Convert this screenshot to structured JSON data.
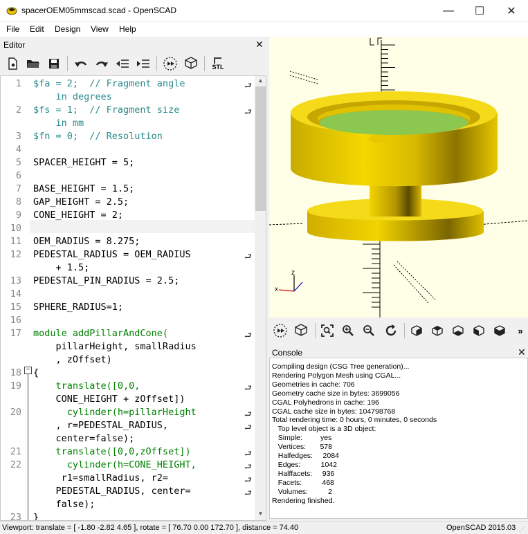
{
  "window": {
    "title": "spacerOEM05mmscad.scad - OpenSCAD",
    "minimize": "—",
    "maximize": "☐",
    "close": "✕"
  },
  "menu": [
    "File",
    "Edit",
    "Design",
    "View",
    "Help"
  ],
  "editor": {
    "title": "Editor",
    "close": "✕",
    "toolbar": [
      "new-icon",
      "open-icon",
      "save-icon",
      "undo-icon",
      "redo-icon",
      "unindent-icon",
      "indent-icon",
      "preview-icon",
      "render-icon",
      "export-stl-icon"
    ],
    "stl_label": "STL",
    "lines": [
      {
        "n": "1",
        "text": "$fa = 2;  // Fragment angle"
      },
      {
        "n": "",
        "text": "    in degrees"
      },
      {
        "n": "2",
        "text": "$fs = 1;  // Fragment size"
      },
      {
        "n": "",
        "text": "    in mm"
      },
      {
        "n": "3",
        "text": "$fn = 0;  // Resolution"
      },
      {
        "n": "4",
        "text": ""
      },
      {
        "n": "5",
        "text": "SPACER_HEIGHT = 5;"
      },
      {
        "n": "6",
        "text": ""
      },
      {
        "n": "7",
        "text": "BASE_HEIGHT = 1.5;"
      },
      {
        "n": "8",
        "text": "GAP_HEIGHT = 2.5;"
      },
      {
        "n": "9",
        "text": "CONE_HEIGHT = 2;"
      },
      {
        "n": "10",
        "text": ""
      },
      {
        "n": "11",
        "text": "OEM_RADIUS = 8.275;"
      },
      {
        "n": "12",
        "text": "PEDESTAL_RADIUS = OEM_RADIUS"
      },
      {
        "n": "",
        "text": "    + 1.5;"
      },
      {
        "n": "13",
        "text": "PEDESTAL_PIN_RADIUS = 2.5;"
      },
      {
        "n": "14",
        "text": ""
      },
      {
        "n": "15",
        "text": "SPHERE_RADIUS=1;"
      },
      {
        "n": "16",
        "text": ""
      },
      {
        "n": "17",
        "text": "module addPillarAndCone("
      },
      {
        "n": "",
        "text": "    pillarHeight, smallRadius"
      },
      {
        "n": "",
        "text": "    , zOffset)"
      },
      {
        "n": "18",
        "text": "{"
      },
      {
        "n": "19",
        "text": "    translate([0,0,"
      },
      {
        "n": "",
        "text": "    CONE_HEIGHT + zOffset])"
      },
      {
        "n": "20",
        "text": "      cylinder(h=pillarHeight"
      },
      {
        "n": "",
        "text": "    , r=PEDESTAL_RADIUS,"
      },
      {
        "n": "",
        "text": "    center=false);"
      },
      {
        "n": "21",
        "text": "    translate([0,0,zOffset])"
      },
      {
        "n": "22",
        "text": "      cylinder(h=CONE_HEIGHT,"
      },
      {
        "n": "",
        "text": "     r1=smallRadius, r2="
      },
      {
        "n": "",
        "text": "    PEDESTAL_RADIUS, center="
      },
      {
        "n": "",
        "text": "    false);"
      },
      {
        "n": "23",
        "text": "}"
      }
    ]
  },
  "viewport": {
    "axis_label": "z",
    "colors": {
      "yellow": "#f2d200",
      "green": "#8cc850",
      "background": "#fffee6"
    }
  },
  "view_toolbar": [
    "preview-icon",
    "render-icon",
    "view-all-icon",
    "zoom-in-icon",
    "zoom-out-icon",
    "reset-view-icon",
    "view-right-icon",
    "view-top-icon",
    "view-bottom-icon",
    "view-left-icon",
    "view-front-icon",
    "more-icon"
  ],
  "view_more": "»",
  "console": {
    "title": "Console",
    "close": "✕",
    "lines": [
      "Compiling design (CSG Tree generation)...",
      "Rendering Polygon Mesh using CGAL...",
      "Geometries in cache: 706",
      "Geometry cache size in bytes: 3699056",
      "CGAL Polyhedrons in cache: 196",
      "CGAL cache size in bytes: 104798768",
      "Total rendering time: 0 hours, 0 minutes, 0 seconds",
      "   Top level object is a 3D object:",
      "   Simple:         yes",
      "   Vertices:       578",
      "   Halfedges:     2084",
      "   Edges:          1042",
      "   Halffacets:     936",
      "   Facets:          468",
      "   Volumes:          2",
      "Rendering finished."
    ]
  },
  "status": {
    "viewport": "Viewport: translate = [ -1.80 -2.82 4.65 ], rotate = [ 76.70 0.00 172.70 ], distance = 74.40",
    "version": "OpenSCAD 2015.03"
  }
}
